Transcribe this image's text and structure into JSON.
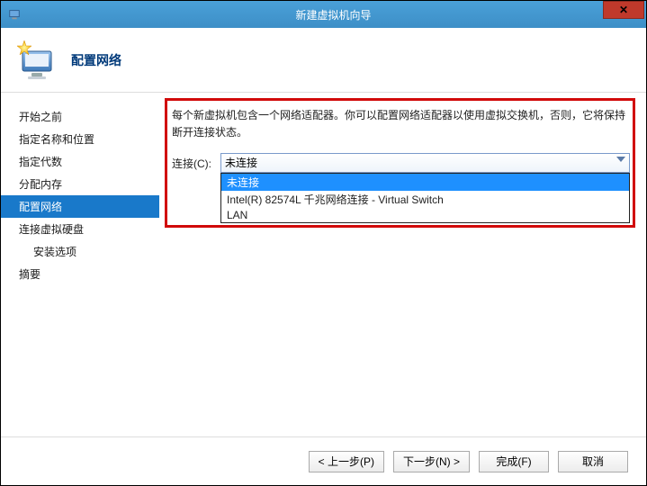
{
  "titlebar": {
    "title": "新建虚拟机向导"
  },
  "header": {
    "title": "配置网络"
  },
  "sidebar": {
    "items": [
      {
        "label": "开始之前",
        "active": false,
        "sub": false
      },
      {
        "label": "指定名称和位置",
        "active": false,
        "sub": false
      },
      {
        "label": "指定代数",
        "active": false,
        "sub": false
      },
      {
        "label": "分配内存",
        "active": false,
        "sub": false
      },
      {
        "label": "配置网络",
        "active": true,
        "sub": false
      },
      {
        "label": "连接虚拟硬盘",
        "active": false,
        "sub": false
      },
      {
        "label": "安装选项",
        "active": false,
        "sub": true
      },
      {
        "label": "摘要",
        "active": false,
        "sub": false
      }
    ]
  },
  "main": {
    "description": "每个新虚拟机包含一个网络适配器。你可以配置网络适配器以使用虚拟交换机，否则，它将保持断开连接状态。",
    "connection_label": "连接(C):",
    "selected_value": "未连接",
    "options": [
      {
        "label": "未连接",
        "selected": true
      },
      {
        "label": "Intel(R) 82574L 千兆网络连接 - Virtual Switch",
        "selected": false
      },
      {
        "label": "LAN",
        "selected": false
      }
    ]
  },
  "footer": {
    "prev": "< 上一步(P)",
    "next": "下一步(N) >",
    "finish": "完成(F)",
    "cancel": "取消"
  }
}
